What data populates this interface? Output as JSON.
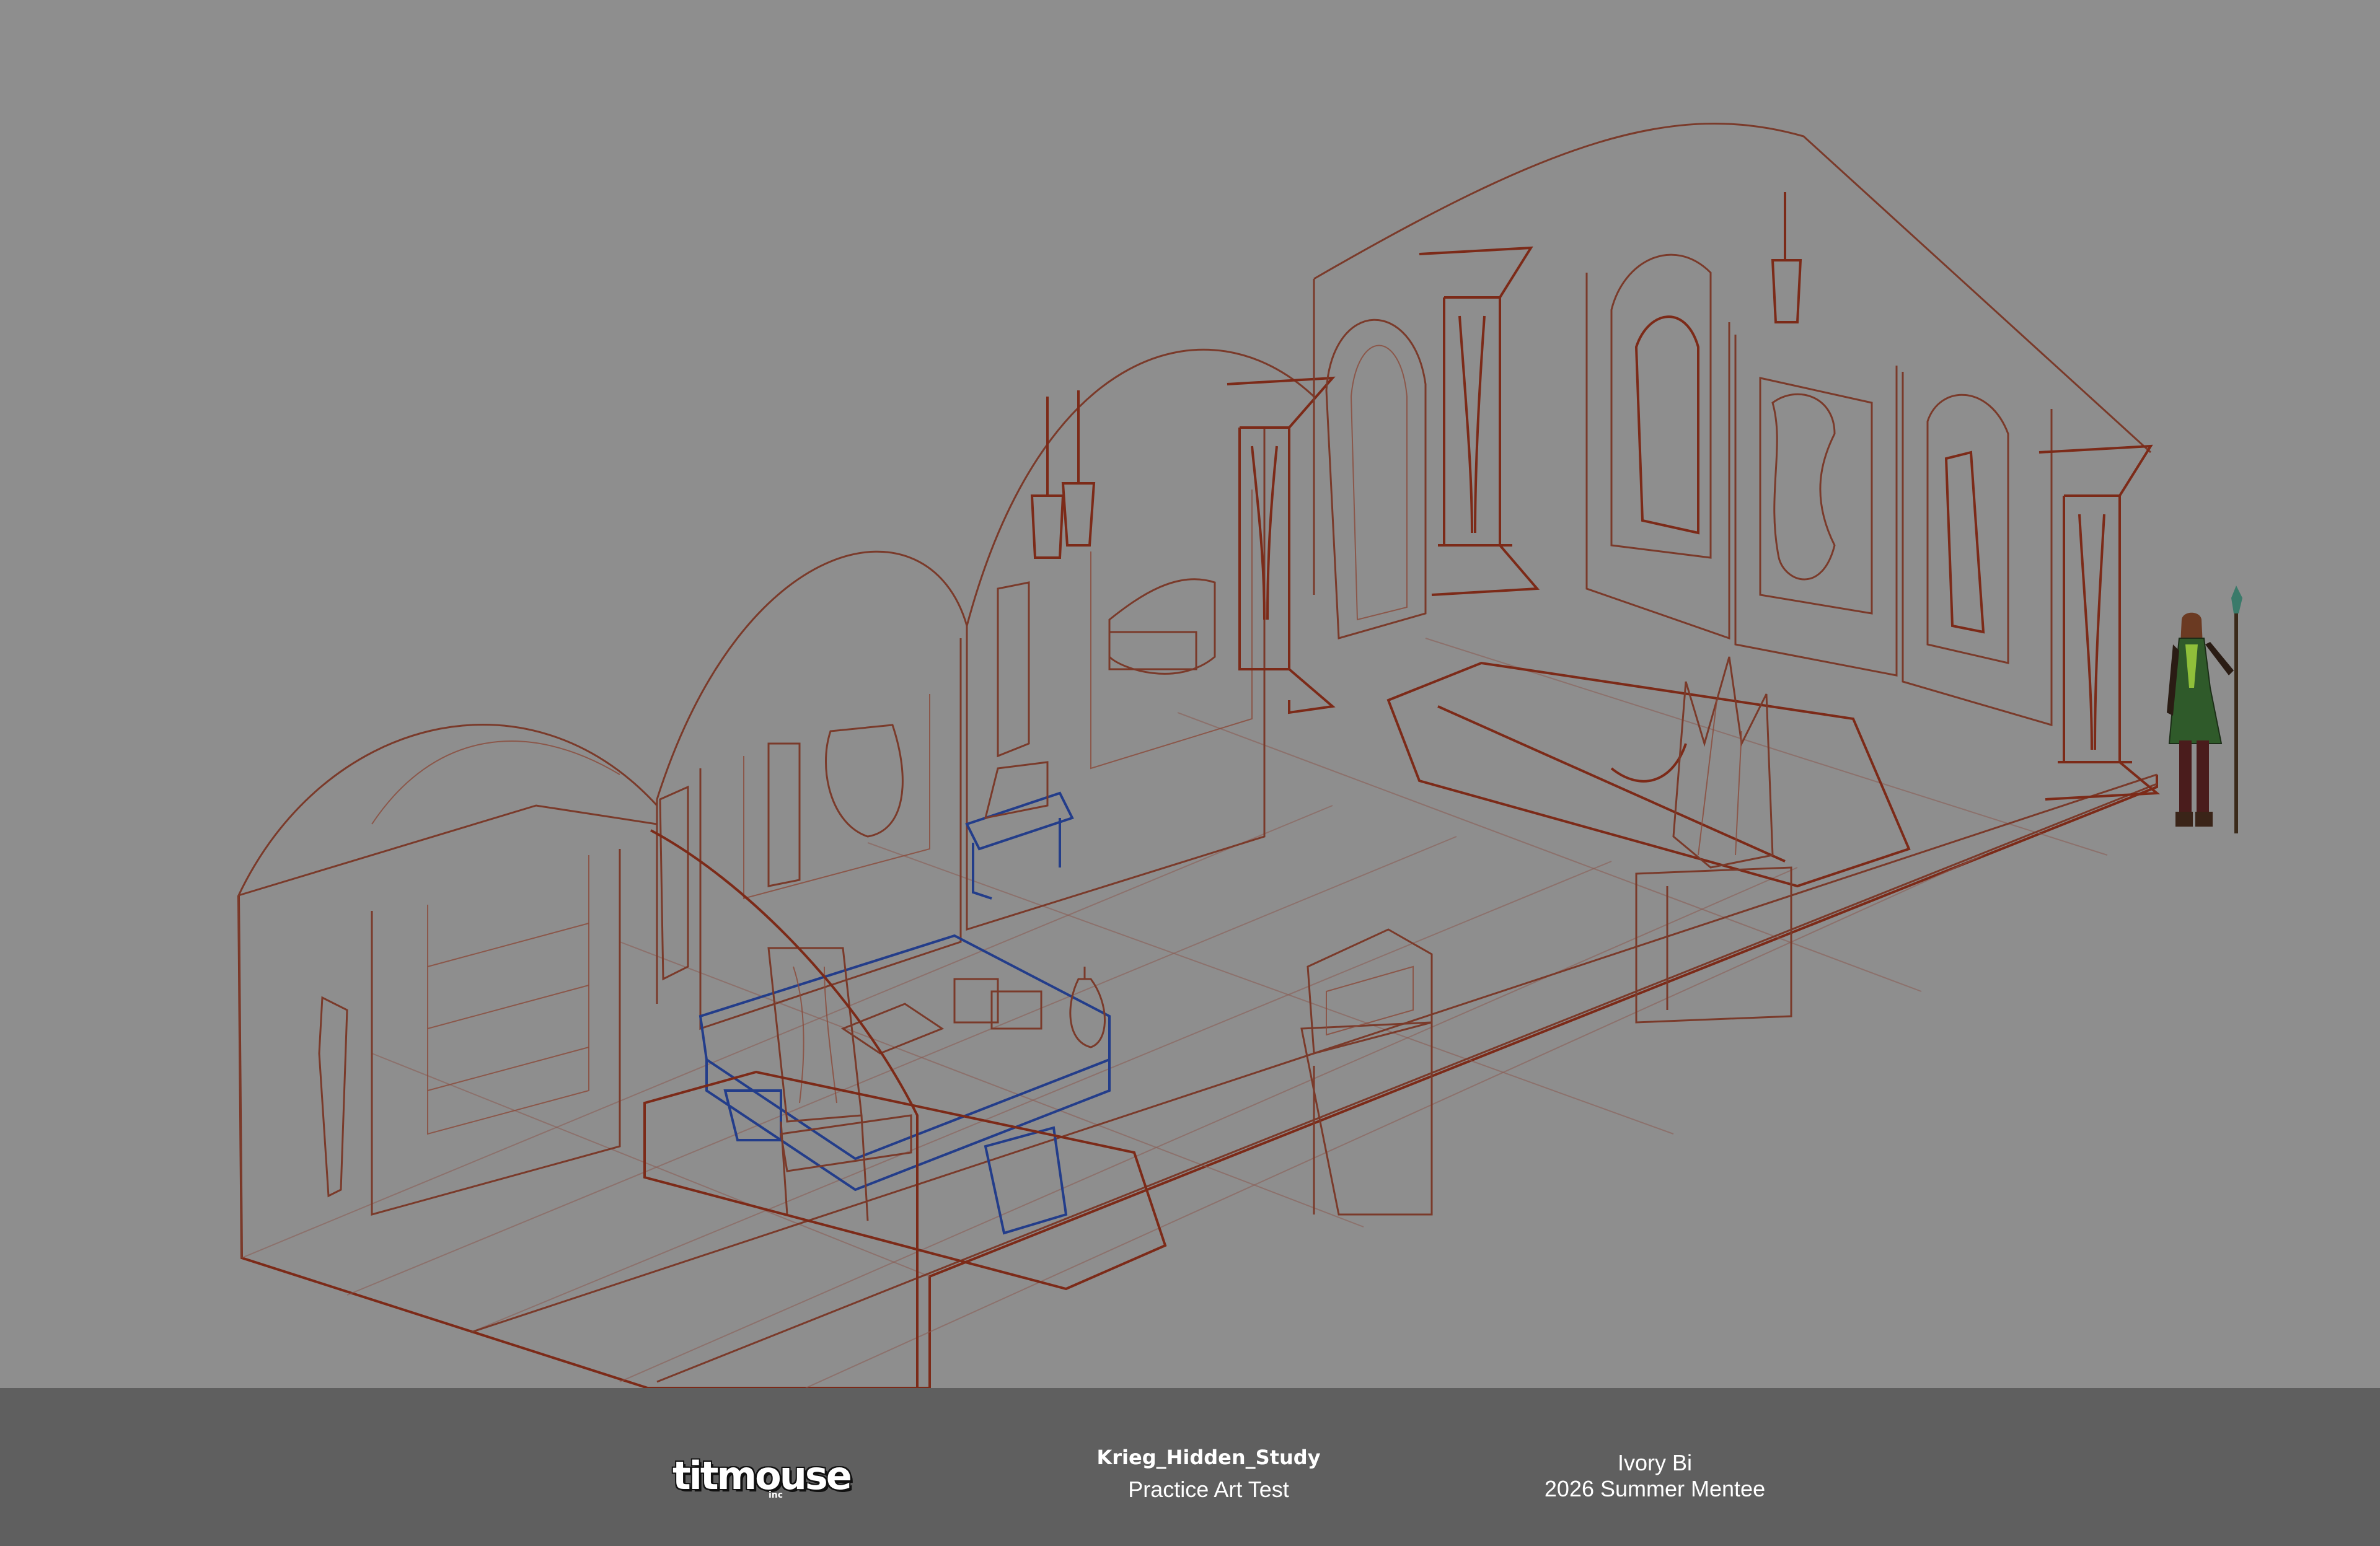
{
  "scene": {
    "description_name": "isometric-room-sketch"
  },
  "footer": {
    "logo_text": "titmouse",
    "logo_suffix": "inc",
    "project_title": "Krieg_Hidden_Study",
    "project_subtitle": "Practice Art Test",
    "artist_name": "Ivory Bi",
    "artist_program": "2026 Summer Mentee"
  },
  "colors": {
    "canvas": "#8e8e8e",
    "footer_band": "#5f5f5f",
    "line_brown": "#7a3a2a",
    "line_blue": "#233d8a",
    "character_green": "#2f5a2a"
  }
}
